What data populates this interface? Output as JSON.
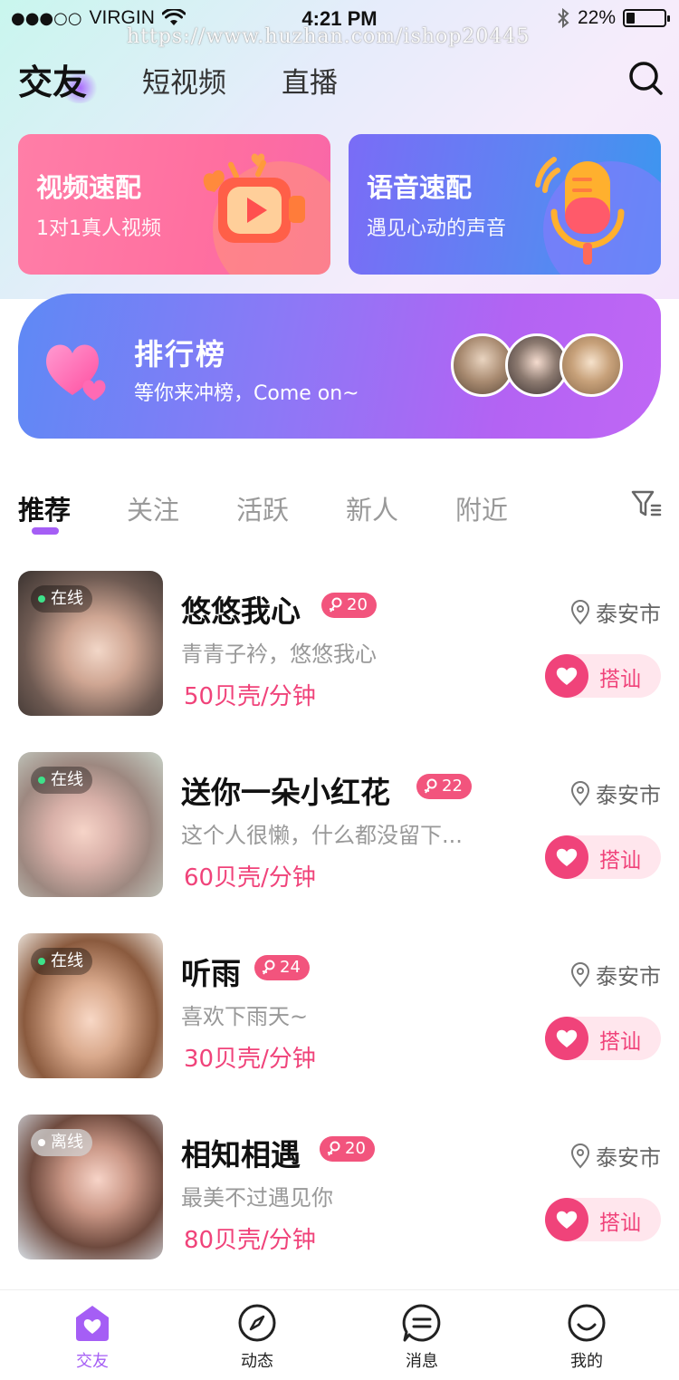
{
  "status_bar": {
    "signal": "●●●○○",
    "carrier": "VIRGIN",
    "time": "4:21 PM",
    "battery_percent": "22%",
    "battery_level": 0.22,
    "watermark": "https://www.huzhan.com/ishop20445"
  },
  "header": {
    "tabs": [
      {
        "label": "交友",
        "active": true
      },
      {
        "label": "短视频",
        "active": false
      },
      {
        "label": "直播",
        "active": false
      }
    ],
    "search_icon": "search-icon"
  },
  "quick_match": {
    "video": {
      "title": "视频速配",
      "subtitle": "1对1真人视频",
      "icon": "video-camera-icon"
    },
    "voice": {
      "title": "语音速配",
      "subtitle": "遇见心动的声音",
      "icon": "microphone-icon"
    }
  },
  "ranking": {
    "title": "排行榜",
    "subtitle": "等你来冲榜，Come on~",
    "icon": "heart-icon"
  },
  "filter_tabs": {
    "tabs": [
      {
        "label": "推荐",
        "active": true
      },
      {
        "label": "关注",
        "active": false
      },
      {
        "label": "活跃",
        "active": false
      },
      {
        "label": "新人",
        "active": false
      },
      {
        "label": "附近",
        "active": false
      }
    ],
    "filter_icon": "filter-icon"
  },
  "users": [
    {
      "status": "在线",
      "online": true,
      "name": "悠悠我心",
      "age": "20",
      "signature": "青青子衿，悠悠我心",
      "price": "50贝壳/分钟",
      "location": "泰安市",
      "greet": "搭讪"
    },
    {
      "status": "在线",
      "online": true,
      "name": "送你一朵小红花",
      "age": "22",
      "signature": "这个人很懒，什么都没留下...",
      "price": "60贝壳/分钟",
      "location": "泰安市",
      "greet": "搭讪"
    },
    {
      "status": "在线",
      "online": true,
      "name": "听雨",
      "age": "24",
      "signature": "喜欢下雨天~",
      "price": "30贝壳/分钟",
      "location": "泰安市",
      "greet": "搭讪"
    },
    {
      "status": "离线",
      "online": false,
      "name": "相知相遇",
      "age": "20",
      "signature": "最美不过遇见你",
      "price": "80贝壳/分钟",
      "location": "泰安市",
      "greet": "搭讪"
    }
  ],
  "bottom_nav": [
    {
      "label": "交友",
      "icon": "heart-home-icon",
      "active": true
    },
    {
      "label": "动态",
      "icon": "compass-icon",
      "active": false
    },
    {
      "label": "消息",
      "icon": "message-icon",
      "active": false
    },
    {
      "label": "我的",
      "icon": "smile-face-icon",
      "active": false
    }
  ],
  "colors": {
    "accent_purple": "#a55ef5",
    "price_pink": "#f0437a",
    "badge_pink": "#f2547d"
  }
}
